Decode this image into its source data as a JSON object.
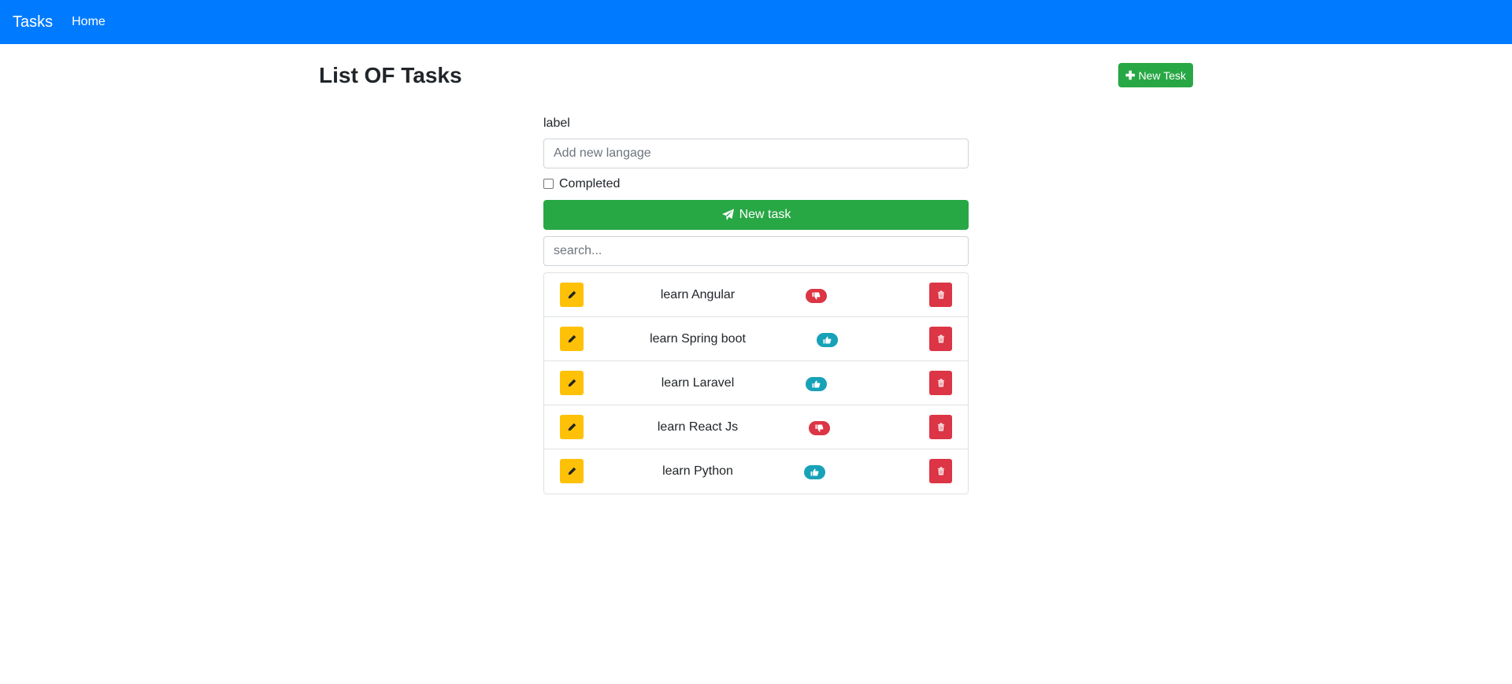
{
  "navbar": {
    "brand": "Tasks",
    "links": [
      "Home"
    ]
  },
  "header": {
    "title": "List OF Tasks",
    "new_tesk_label": "New Tesk"
  },
  "form": {
    "label": "label",
    "input_placeholder": "Add new langage",
    "input_value": "",
    "completed_label": "Completed",
    "completed_checked": false,
    "submit_label": "New task",
    "search_placeholder": "search..."
  },
  "tasks": [
    {
      "label": "learn Angular",
      "completed": false
    },
    {
      "label": "learn Spring boot",
      "completed": true
    },
    {
      "label": "learn Laravel",
      "completed": true
    },
    {
      "label": "learn React Js",
      "completed": false
    },
    {
      "label": "learn Python",
      "completed": true
    }
  ],
  "icons": {
    "edit": "pencil-icon",
    "delete": "trash-icon",
    "completed": "thumbs-up-icon",
    "not_completed": "thumbs-down-icon",
    "submit": "paper-plane-icon",
    "add": "plus-icon"
  },
  "colors": {
    "navbar": "#007bff",
    "success": "#28a745",
    "warning": "#ffc107",
    "danger": "#dc3545",
    "info": "#17a2b8"
  }
}
